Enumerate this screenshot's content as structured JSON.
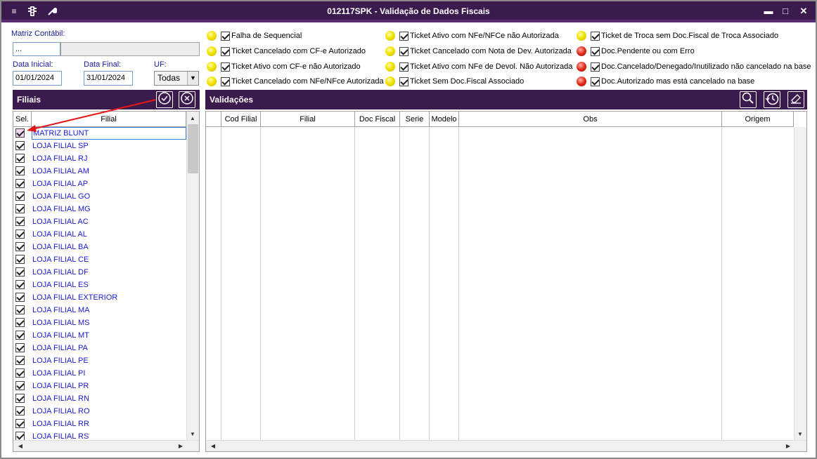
{
  "window": {
    "title": "012117SPK - Validação de Dados Fiscais"
  },
  "filters": {
    "matriz_label": "Matriz Contábil:",
    "matriz_value": "...",
    "data_inicial_label": "Data Inicial:",
    "data_inicial_value": "01/01/2024",
    "data_final_label": "Data Final:",
    "data_final_value": "31/01/2024",
    "uf_label": "UF:",
    "uf_value": "Todas"
  },
  "legend": [
    {
      "color": "yellow",
      "label": "Falha de Sequencial"
    },
    {
      "color": "yellow",
      "label": "Ticket Cancelado com CF-e Autorizado"
    },
    {
      "color": "yellow",
      "label": "Ticket Ativo com CF-e não Autorizado"
    },
    {
      "color": "yellow",
      "label": "Ticket Cancelado com NFe/NFce Autorizada"
    },
    {
      "color": "yellow",
      "label": "Ticket Ativo com NFe/NFCe não Autorizada"
    },
    {
      "color": "yellow",
      "label": "Ticket Cancelado com Nota de Dev. Autorizada"
    },
    {
      "color": "yellow",
      "label": "Ticket Ativo com NFe de Devol. Não Autorizada"
    },
    {
      "color": "yellow",
      "label": "Ticket Sem Doc.Fiscal Associado"
    },
    {
      "color": "yellow",
      "label": "Ticket de Troca sem Doc.Fiscal de Troca Associado"
    },
    {
      "color": "red",
      "label": "Doc.Pendente ou com Erro"
    },
    {
      "color": "red",
      "label": "Doc.Cancelado/Denegado/Inutilizado não cancelado na base"
    },
    {
      "color": "red",
      "label": "Doc.Autorizado mas está cancelado na base"
    }
  ],
  "filiais": {
    "title": "Filiais",
    "col_sel": "Sel.",
    "col_filial": "Filial",
    "rows": [
      "MATRIZ BLUNT",
      "LOJA FILIAL SP",
      "LOJA FILIAL RJ",
      "LOJA FILIAL AM",
      "LOJA FILIAL AP",
      "LOJA FILIAL GO",
      "LOJA FILIAL MG",
      "LOJA FILIAL AC",
      "LOJA FILIAL AL",
      "LOJA FILIAL BA",
      "LOJA FILIAL CE",
      "LOJA FILIAL DF",
      "LOJA FILIAL ES",
      "LOJA FILIAL EXTERIOR",
      "LOJA FILIAL MA",
      "LOJA FILIAL MS",
      "LOJA FILIAL MT",
      "LOJA FILIAL PA",
      "LOJA FILIAL PE",
      "LOJA FILIAL PI",
      "LOJA FILIAL PR",
      "LOJA FILIAL RN",
      "LOJA FILIAL RO",
      "LOJA FILIAL RR",
      "LOJA FILIAL RS"
    ]
  },
  "validacoes": {
    "title": "Validações",
    "columns": [
      "Cod Filial",
      "Filial",
      "Doc Fiscal",
      "Serie",
      "Modelo",
      "Obs",
      "Origem"
    ]
  }
}
